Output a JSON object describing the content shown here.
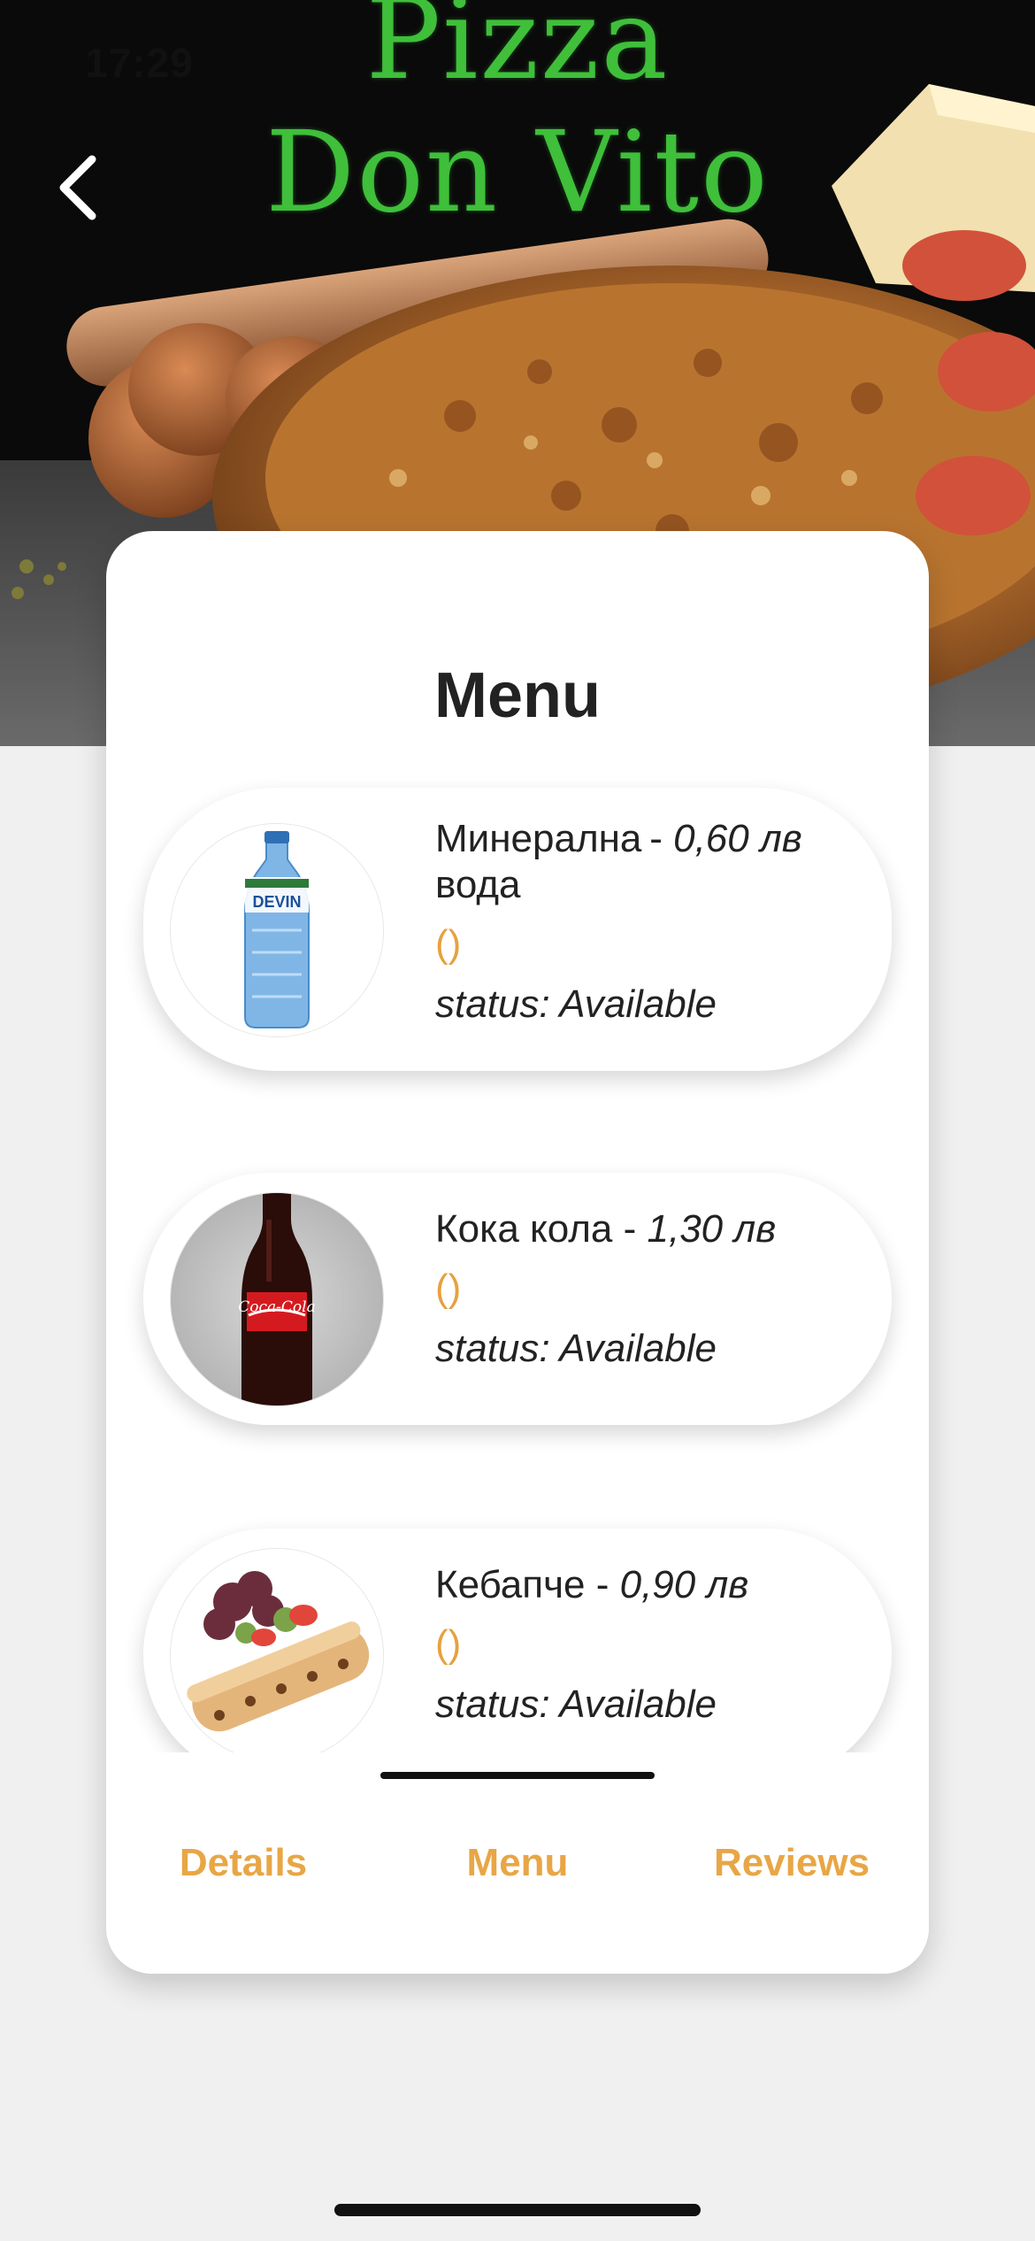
{
  "status_bar": {
    "time": "17:29"
  },
  "hero": {
    "title_line1": "Pizza",
    "title_line2": "Don Vito",
    "back_icon": "chevron-left-icon"
  },
  "card": {
    "title": "Menu"
  },
  "menu": {
    "items": [
      {
        "name": "Минерална вода",
        "separator": " - ",
        "price": "0,60 лв",
        "rating": "()",
        "status_label": "status:",
        "status_value": "Available",
        "image": "water-bottle-image"
      },
      {
        "name": "Кока кола",
        "separator": " - ",
        "price": "1,30 лв",
        "rating": "()",
        "status_label": "status:",
        "status_value": "Available",
        "image": "cola-bottle-image"
      },
      {
        "name": "Кебапче",
        "separator": " - ",
        "price": "0,90 лв",
        "rating": "()",
        "status_label": "status:",
        "status_value": "Available",
        "image": "kebapche-image"
      }
    ]
  },
  "tabs": {
    "items": [
      {
        "label": "Details"
      },
      {
        "label": "Menu"
      },
      {
        "label": "Reviews"
      }
    ],
    "active": "Menu"
  },
  "colors": {
    "accent": "#e8a646",
    "title_green": "#3fbf3a",
    "background": "#f0f0f0",
    "card": "#ffffff"
  }
}
